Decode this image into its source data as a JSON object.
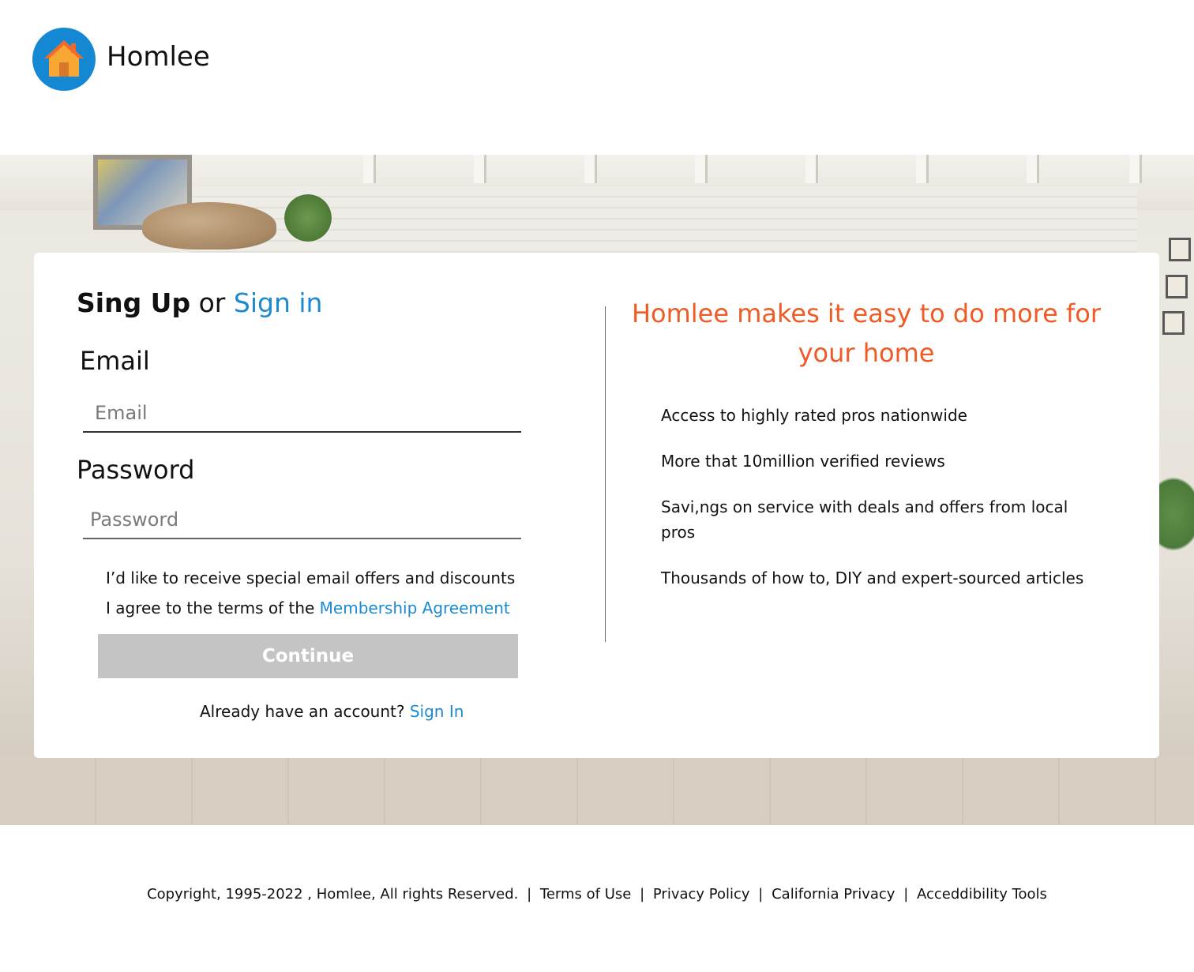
{
  "brand": {
    "name": "Homlee",
    "logo_icon": "house-icon",
    "logo_bg": "#1588d3"
  },
  "signup": {
    "heading_bold": "Sing Up",
    "heading_or": "or",
    "heading_link": "Sign in",
    "email_label": "Email",
    "email_placeholder": "Email",
    "email_value": "",
    "password_label": "Password",
    "password_placeholder": "Password",
    "password_value": "",
    "offers_text": "I’d like to receive special email offers and discounts",
    "agree_text": "I agree to the terms of the",
    "agree_link": "Membership Agreement",
    "continue_label": "Continue",
    "already_text": "Already have an account?",
    "already_link": "Sign In"
  },
  "promo": {
    "title": "Homlee makes it easy to do more for your home",
    "benefits": [
      "Access to highly rated pros nationwide",
      "More that 10million verified reviews",
      "Savi,ngs on service with deals and offers from local pros",
      "Thousands of how to, DIY and expert-sourced articles"
    ]
  },
  "footer": {
    "copyright": "Copyright, 1995-2022 , Homlee, All rights Reserved.",
    "separator": "|",
    "links": [
      "Terms of Use",
      "Privacy Policy",
      "California Privacy",
      "Acceddibility Tools"
    ]
  },
  "colors": {
    "accent_blue": "#1c8ad0",
    "promo_orange": "#f05a24",
    "button_disabled": "#c4c4c4"
  }
}
